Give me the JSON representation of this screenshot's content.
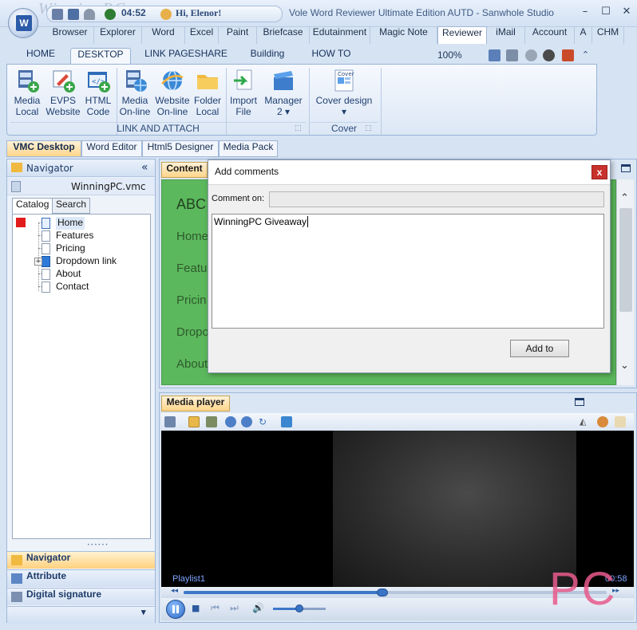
{
  "titlebar": {
    "watermark": "WinningPC",
    "clock": "04:52",
    "greeting": "Hi, Elenor!",
    "title": "Vole Word Reviewer Ultimate Edition AUTD - Sanwhole Studio",
    "minimize": "–",
    "maximize": "☐",
    "close": "✕"
  },
  "app_tabs": [
    "Browser",
    "Explorer",
    "Word",
    "Excel",
    "Paint",
    "Briefcase",
    "Edutainment",
    "Magic Note",
    "Reviewer",
    "iMail",
    "Account",
    "A",
    "CHM"
  ],
  "ribbon_tabs": [
    "HOME",
    "DESKTOP",
    "LINK PAGESHARE",
    "Building",
    "HOW TO"
  ],
  "zoom": "100%",
  "ribbon": {
    "buttons": [
      {
        "line1": "Media",
        "line2": "Local"
      },
      {
        "line1": "EVPS",
        "line2": "Website"
      },
      {
        "line1": "HTML",
        "line2": "Code"
      },
      {
        "line1": "Media",
        "line2": "On-line"
      },
      {
        "line1": "Website",
        "line2": "On-line"
      },
      {
        "line1": "Folder",
        "line2": "Local"
      },
      {
        "line1": "Import",
        "line2": "File"
      },
      {
        "line1": "Manager",
        "line2": "2 ▾"
      },
      {
        "line1": "Cover design",
        "line2": "▾"
      }
    ],
    "cover_icon_text": "Cover",
    "group_link": "LINK AND ATTACH",
    "group_cover": "Cover"
  },
  "doc_tabs": [
    "VMC Desktop",
    "Word Editor",
    "Html5 Designer",
    "Media Pack"
  ],
  "navigator": {
    "title": "Navigator",
    "collapse": "«",
    "file": "WinningPC.vmc",
    "tabs": [
      "Catalog",
      "Search"
    ],
    "tree": [
      "Home",
      "Features",
      "Pricing",
      "Dropdown link",
      "About",
      "Contact"
    ],
    "expander": "+",
    "grip": "••••••",
    "sections": [
      "Navigator",
      "Attribute",
      "Digital signature"
    ],
    "dropdown": "▾"
  },
  "content": {
    "tab": "Content",
    "heading": "ABC",
    "menu": [
      "Home",
      "Featu",
      "Pricin",
      "Dropo",
      "About"
    ],
    "scroll_up": "⌃",
    "scroll_down": "⌄"
  },
  "dialog": {
    "title": "Add comments",
    "close": "x",
    "comment_label": "Comment on:",
    "comment_on_value": "",
    "comment_text": "WinningPC Giveaway",
    "add_button": "Add to"
  },
  "media": {
    "tab": "Media player",
    "playlist": "Playlist1",
    "time": "00:58",
    "seek_prev": "◂◂",
    "seek_next": "▸▸",
    "stop": "■",
    "prev": "⏮",
    "next": "⏭",
    "volume": "🔊",
    "progress": 0.47,
    "volume_level": 0.5
  },
  "watermark_br": "PC",
  "colors": {
    "accent_orange": "#ffd58a",
    "content_green": "#5cb85c",
    "dialog_close": "#c8322c",
    "ribbon_blue": "#1f3f70"
  }
}
